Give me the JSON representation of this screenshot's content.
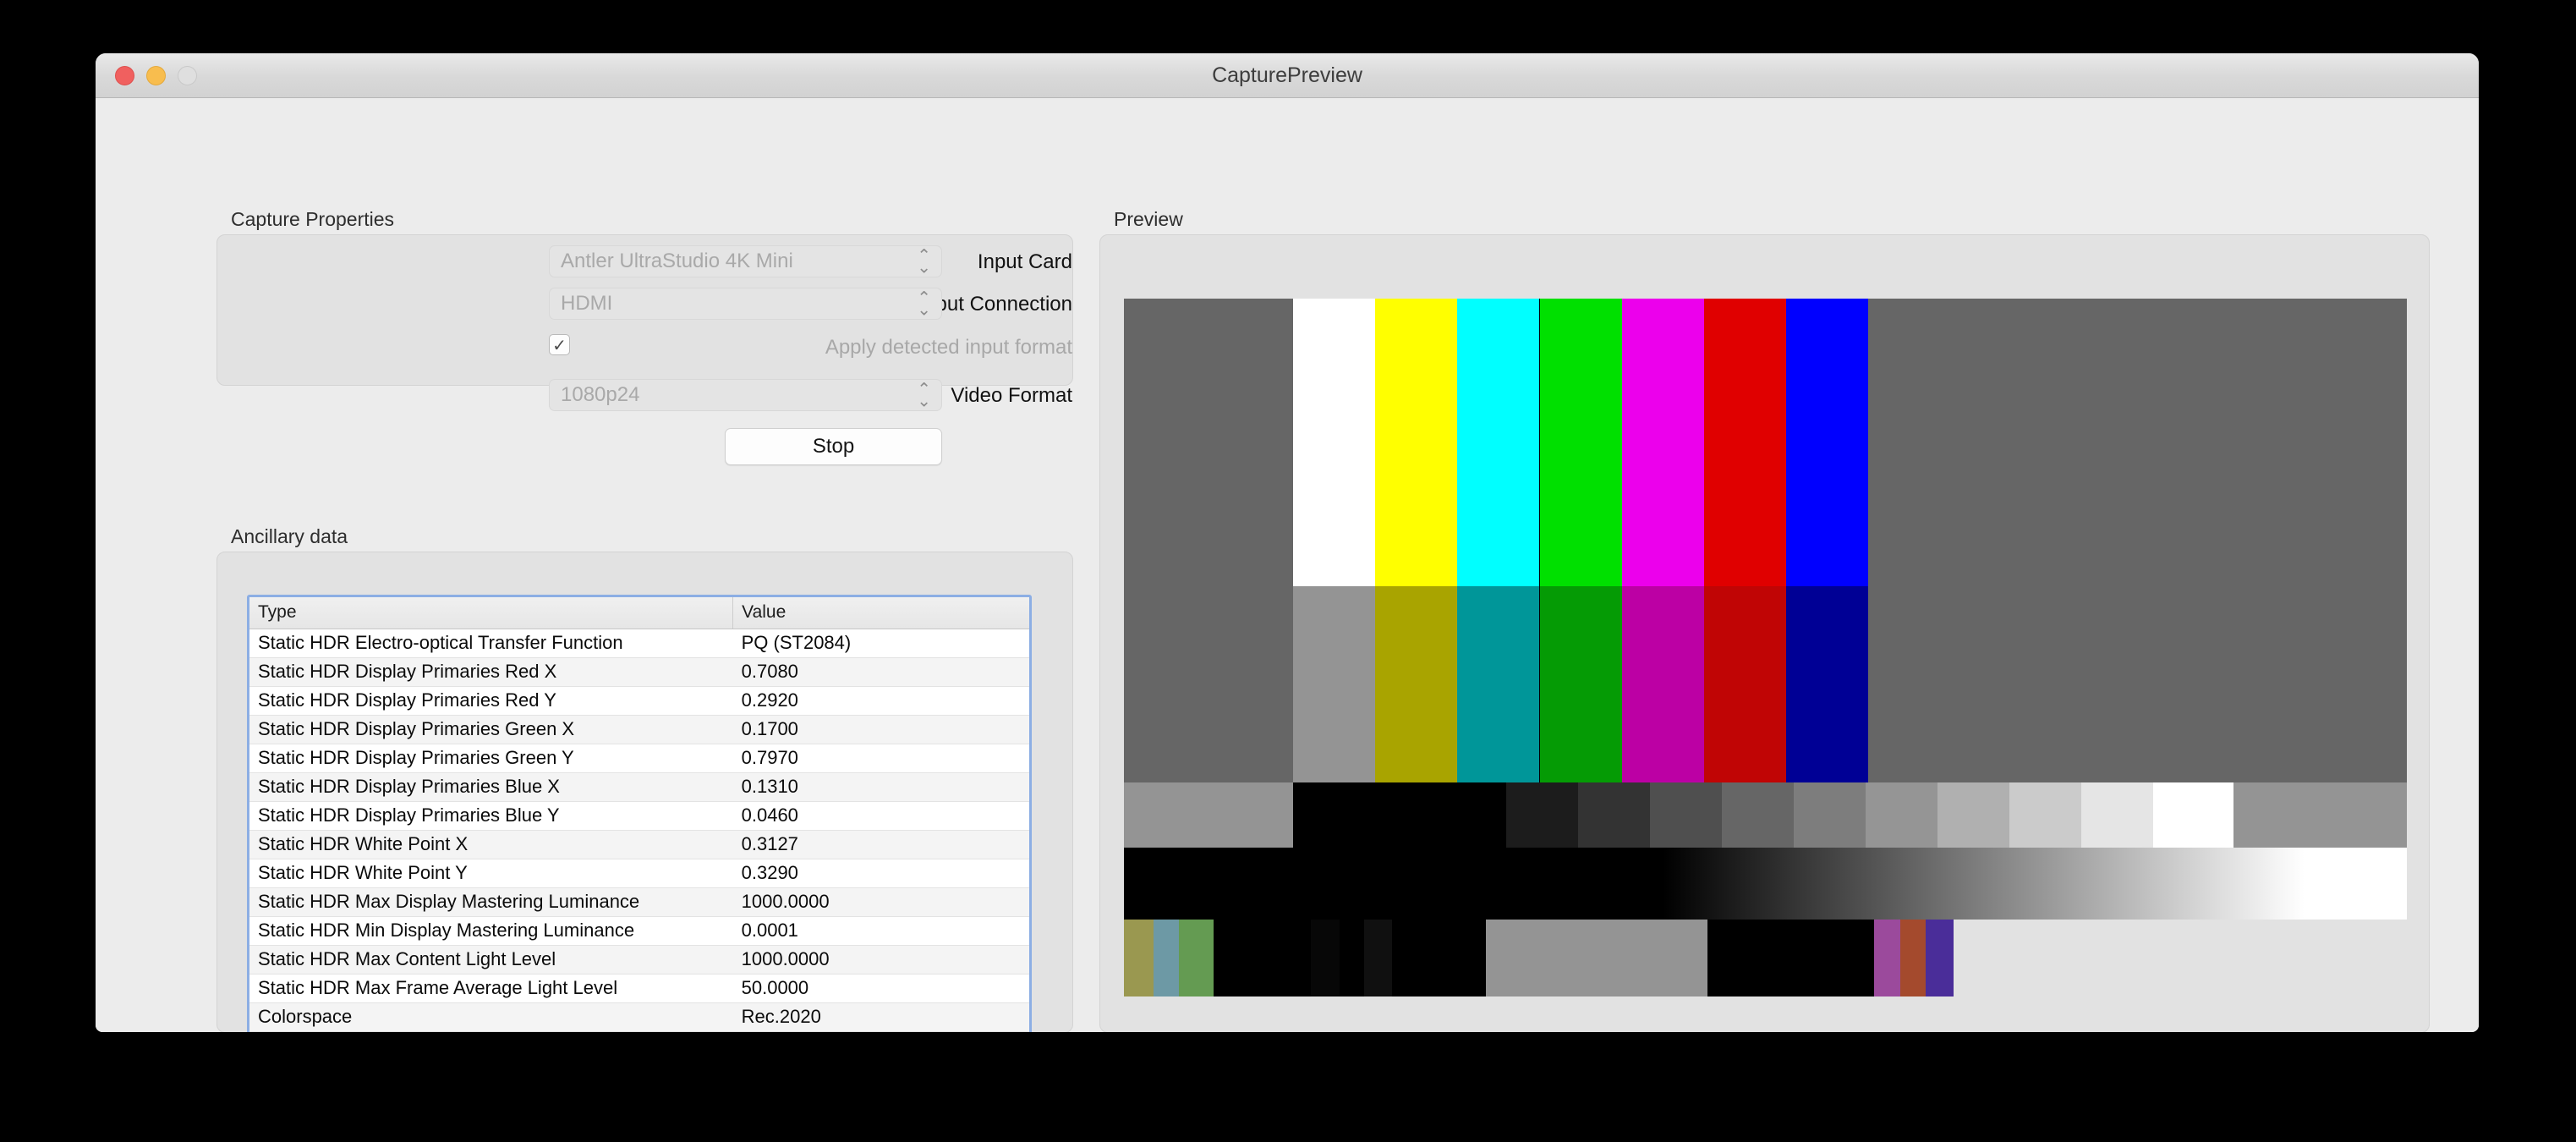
{
  "window": {
    "title": "CapturePreview",
    "traffic_lights": [
      "close-button",
      "minimize-button",
      "zoom-button"
    ]
  },
  "capture_properties": {
    "legend": "Capture Properties",
    "fields": [
      {
        "label": "Input Card",
        "value": "Antler UltraStudio 4K Mini",
        "type": "combobox"
      },
      {
        "label": "Input Connection",
        "value": "HDMI",
        "type": "combobox"
      },
      {
        "label": "Apply detected input format",
        "value": "checked",
        "type": "checkbox"
      },
      {
        "label": "Video Format",
        "value": "1080p24",
        "type": "combobox"
      }
    ],
    "stop_button": "Stop",
    "stepper_up": "⌃",
    "stepper_down": "⌄",
    "check_glyph": "✓"
  },
  "ancillary": {
    "legend": "Ancillary data",
    "columns": [
      "Type",
      "Value"
    ],
    "rows": [
      [
        "Static HDR Electro-optical Transfer Function",
        "PQ (ST2084)"
      ],
      [
        "Static HDR Display Primaries Red X",
        "0.7080"
      ],
      [
        "Static HDR Display Primaries Red Y",
        "0.2920"
      ],
      [
        "Static HDR Display Primaries Green X",
        "0.1700"
      ],
      [
        "Static HDR Display Primaries Green Y",
        "0.7970"
      ],
      [
        "Static HDR Display Primaries Blue X",
        "0.1310"
      ],
      [
        "Static HDR Display Primaries Blue Y",
        "0.0460"
      ],
      [
        "Static HDR White Point X",
        "0.3127"
      ],
      [
        "Static HDR White Point Y",
        "0.3290"
      ],
      [
        "Static HDR Max Display Mastering Luminance",
        "1000.0000"
      ],
      [
        "Static HDR Min Display Mastering Luminance",
        "0.0001"
      ],
      [
        "Static HDR Max Content Light Level",
        "1000.0000"
      ],
      [
        "Static HDR Max Frame Average Light Level",
        "50.0000"
      ],
      [
        "Colorspace",
        "Rec.2020"
      ]
    ],
    "selection_color": "#8caee4"
  },
  "preview": {
    "legend": "Preview",
    "test_pattern": {
      "name": "hdr-color-bars",
      "bars_row1": [
        {
          "color": "#666666",
          "left": 0,
          "width": 13.2
        },
        {
          "color": "#ffffff",
          "left": 13.2,
          "width": 6.4
        },
        {
          "color": "#ffff00",
          "left": 19.6,
          "width": 6.4
        },
        {
          "color": "#00ffff",
          "left": 26.0,
          "width": 6.4
        },
        {
          "color": "#00e000",
          "left": 32.4,
          "width": 6.4
        },
        {
          "color": "#ec00ec",
          "left": 38.8,
          "width": 6.4
        },
        {
          "color": "#e00000",
          "left": 45.2,
          "width": 6.4
        },
        {
          "color": "#0000ff",
          "left": 51.6,
          "width": 6.4
        },
        {
          "color": "#666666",
          "left": 58.0,
          "width": 42.0
        }
      ],
      "bars_row2": [
        {
          "color": "#666666",
          "left": 0,
          "width": 13.2
        },
        {
          "color": "#949494",
          "left": 13.2,
          "width": 6.4
        },
        {
          "color": "#a9a400",
          "left": 19.6,
          "width": 6.4
        },
        {
          "color": "#009699",
          "left": 26.0,
          "width": 6.4
        },
        {
          "color": "#059b05",
          "left": 32.4,
          "width": 6.4
        },
        {
          "color": "#bc00a4",
          "left": 38.8,
          "width": 6.4
        },
        {
          "color": "#c00505",
          "left": 45.2,
          "width": 6.4
        },
        {
          "color": "#000095",
          "left": 51.6,
          "width": 6.4
        },
        {
          "color": "#666666",
          "left": 58.0,
          "width": 42.0
        }
      ],
      "steps": [
        {
          "color": "#949494",
          "left": 0,
          "width": 13.2
        },
        {
          "color": "#000000",
          "left": 13.2,
          "width": 16.6
        },
        {
          "color": "#1c1c1c",
          "left": 29.8,
          "width": 5.6
        },
        {
          "color": "#333333",
          "left": 35.4,
          "width": 5.6
        },
        {
          "color": "#4f4f4f",
          "left": 41.0,
          "width": 5.6
        },
        {
          "color": "#666666",
          "left": 46.6,
          "width": 5.6
        },
        {
          "color": "#7d7d7d",
          "left": 52.2,
          "width": 5.6
        },
        {
          "color": "#959595",
          "left": 57.8,
          "width": 5.6
        },
        {
          "color": "#b0b0b0",
          "left": 63.4,
          "width": 5.6
        },
        {
          "color": "#cbcbcb",
          "left": 69.0,
          "width": 5.6
        },
        {
          "color": "#e5e5e5",
          "left": 74.6,
          "width": 5.6
        },
        {
          "color": "#ffffff",
          "left": 80.2,
          "width": 6.3
        },
        {
          "color": "#949494",
          "left": 86.5,
          "width": 13.5
        }
      ],
      "ramp": {
        "type": "linear-gradient",
        "from": "#000000",
        "to": "#ffffff",
        "black_hold_pct": 42
      },
      "bottom": [
        {
          "color": "#9a9850",
          "left": 0,
          "width": 2.3
        },
        {
          "color": "#6d99a5",
          "left": 2.3,
          "width": 2.0
        },
        {
          "color": "#649b52",
          "left": 4.3,
          "width": 2.7
        },
        {
          "color": "#000000",
          "left": 7.0,
          "width": 7.6
        },
        {
          "color": "#070707",
          "left": 14.6,
          "width": 2.2
        },
        {
          "color": "#000000",
          "left": 16.8,
          "width": 1.9
        },
        {
          "color": "#101010",
          "left": 18.7,
          "width": 2.2
        },
        {
          "color": "#000000",
          "left": 20.9,
          "width": 7.3
        },
        {
          "color": "#949494",
          "left": 28.2,
          "width": 17.3
        },
        {
          "color": "#000000",
          "left": 45.5,
          "width": 13.0
        },
        {
          "color": "#9b4a9c",
          "left": 58.5,
          "width": 2.0
        },
        {
          "color": "#a44a2d",
          "left": 60.5,
          "width": 2.0
        },
        {
          "color": "#4a2d99",
          "left": 62.5,
          "width": 2.2
        },
        {
          "color": "#e2e2e2",
          "left": 64.7,
          "width": 35.3
        }
      ]
    }
  }
}
